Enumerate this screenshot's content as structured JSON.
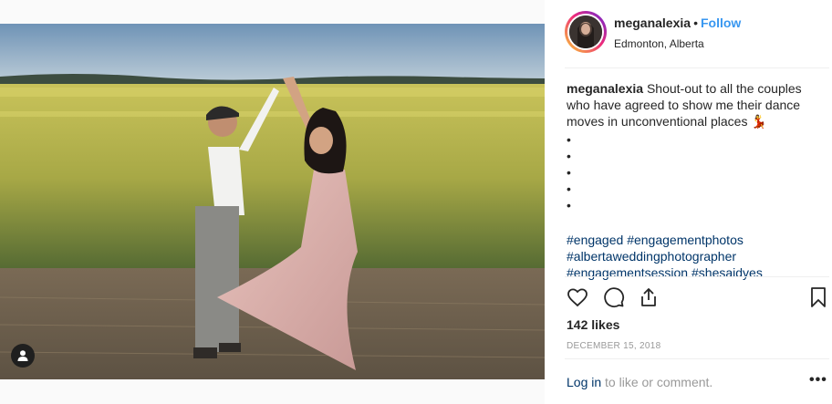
{
  "post": {
    "username": "meganalexia",
    "separator": "•",
    "follow_label": "Follow",
    "location": "Edmonton, Alberta",
    "caption": {
      "username": "meganalexia",
      "text": "Shout-out to all the couples who have agreed to show me their dance moves in unconventional places 💃",
      "bullets": [
        "•",
        "•",
        "•",
        "•",
        "•"
      ],
      "hashtags_line1": [
        "#engaged",
        "#engagementphotos"
      ],
      "hashtags_line2": [
        "#albertaweddingphotographer"
      ],
      "hashtags_line3": [
        "#engagementsession",
        "#shesaidyes"
      ]
    },
    "likes": "142 likes",
    "date": "DECEMBER 15, 2018",
    "login_link": "Log in",
    "login_suffix": " to like or comment.",
    "more": "•••"
  },
  "icons": {
    "like": "heart-icon",
    "comment": "comment-icon",
    "share": "share-icon",
    "save": "bookmark-icon",
    "user_tag": "user-icon"
  },
  "colors": {
    "follow": "#3897f0",
    "link": "#003569",
    "muted": "#999999",
    "text": "#262626"
  }
}
